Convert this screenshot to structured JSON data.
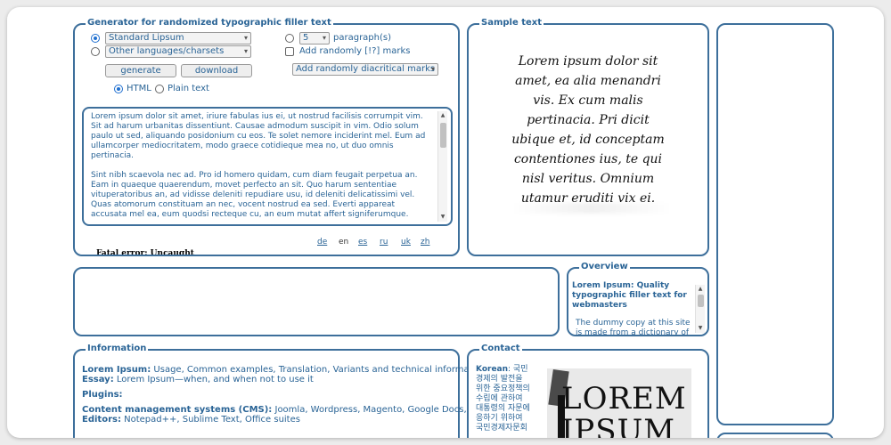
{
  "generator": {
    "legend": "Generator for randomized typographic filler text",
    "type_select": "Standard Lipsum",
    "lang_select": "Other languages/charsets",
    "para_count": "5",
    "para_label": "paragraph(s)",
    "marks_label": "Add randomly [!?] marks",
    "diacritic_select": "Add randomly diacritical marks",
    "generate_label": "generate",
    "download_label": "download",
    "html_label": "HTML",
    "plain_label": "Plain text",
    "paragraph1": "Lorem ipsum dolor sit amet, iriure fabulas ius ei, ut nostrud facilisis corrumpit vim. Sit ad harum urbanitas dissentiunt. Causae admodum suscipit in vim. Odio solum paulo ut sed, aliquando posidonium cu eos. Te solet nemore inciderint mel. Eum ad ullamcorper mediocritatem, modo graece cotidieque mea no, ut duo omnis pertinacia.",
    "paragraph2": "Sint nibh scaevola nec ad. Pro id homero quidam, cum diam feugait perpetua an. Eam in quaeque quaerendum, movet perfecto an sit. Quo harum sententiae vituperatoribus an, ad vidisse deleniti repudiare usu, id deleniti delicatissimi vel. Quas atomorum constituam an nec, vocent nostrud ea sed. Everti appareat accusata mel ea, eum quodsi recteque cu, an eum mutat affert signiferumque.",
    "langs": [
      "de",
      "en",
      "es",
      "ru",
      "uk",
      "zh"
    ],
    "fatal_error": "Fatal error: Uncaught"
  },
  "sample": {
    "legend": "Sample text",
    "lines": [
      "Lorem ipsum dolor sit",
      "amet, ea alia menandri",
      "vis. Ex cum malis",
      "pertinacia. Pri dicit",
      "ubique et, id conceptam",
      "contentiones ius, te qui",
      "nisl veritus. Omnium",
      "utamur eruditi vix ei."
    ]
  },
  "overview": {
    "legend": "Overview",
    "title": "Lorem Ipsum: Quality typographic filler text for webmasters",
    "body": "The dummy copy at this site is made from a dictionary of"
  },
  "information": {
    "legend": "Information",
    "line1_bold": "Lorem Ipsum:",
    "line1_text": " Usage, Common examples, Translation, Variants and technical information",
    "line2_bold": "Essay:",
    "line2_text": " Lorem Ipsum—when, and when not to use it",
    "line3_bold": "Plugins:",
    "line4_bold": "Content management systems (CMS):",
    "line4_text": " Joomla, Wordpress, Magento, Google Docs, Drupal",
    "line5_bold": "Editors:",
    "line5_text": " Notepad++, Sublime Text, Office suites"
  },
  "contact": {
    "legend": "Contact",
    "korean_label": "Korean",
    "korean_lines": [
      ": 국민",
      "경제의 발전을",
      "위한 중요정책의",
      "수립에 관하여",
      "대통령의 자문에",
      "응하기 위하여",
      "국민경제자문회"
    ],
    "image_text_1": "LOREM",
    "image_text_2": "IPSUM"
  },
  "colors": {
    "border": "#3d6f9b",
    "text": "#2a6496"
  }
}
